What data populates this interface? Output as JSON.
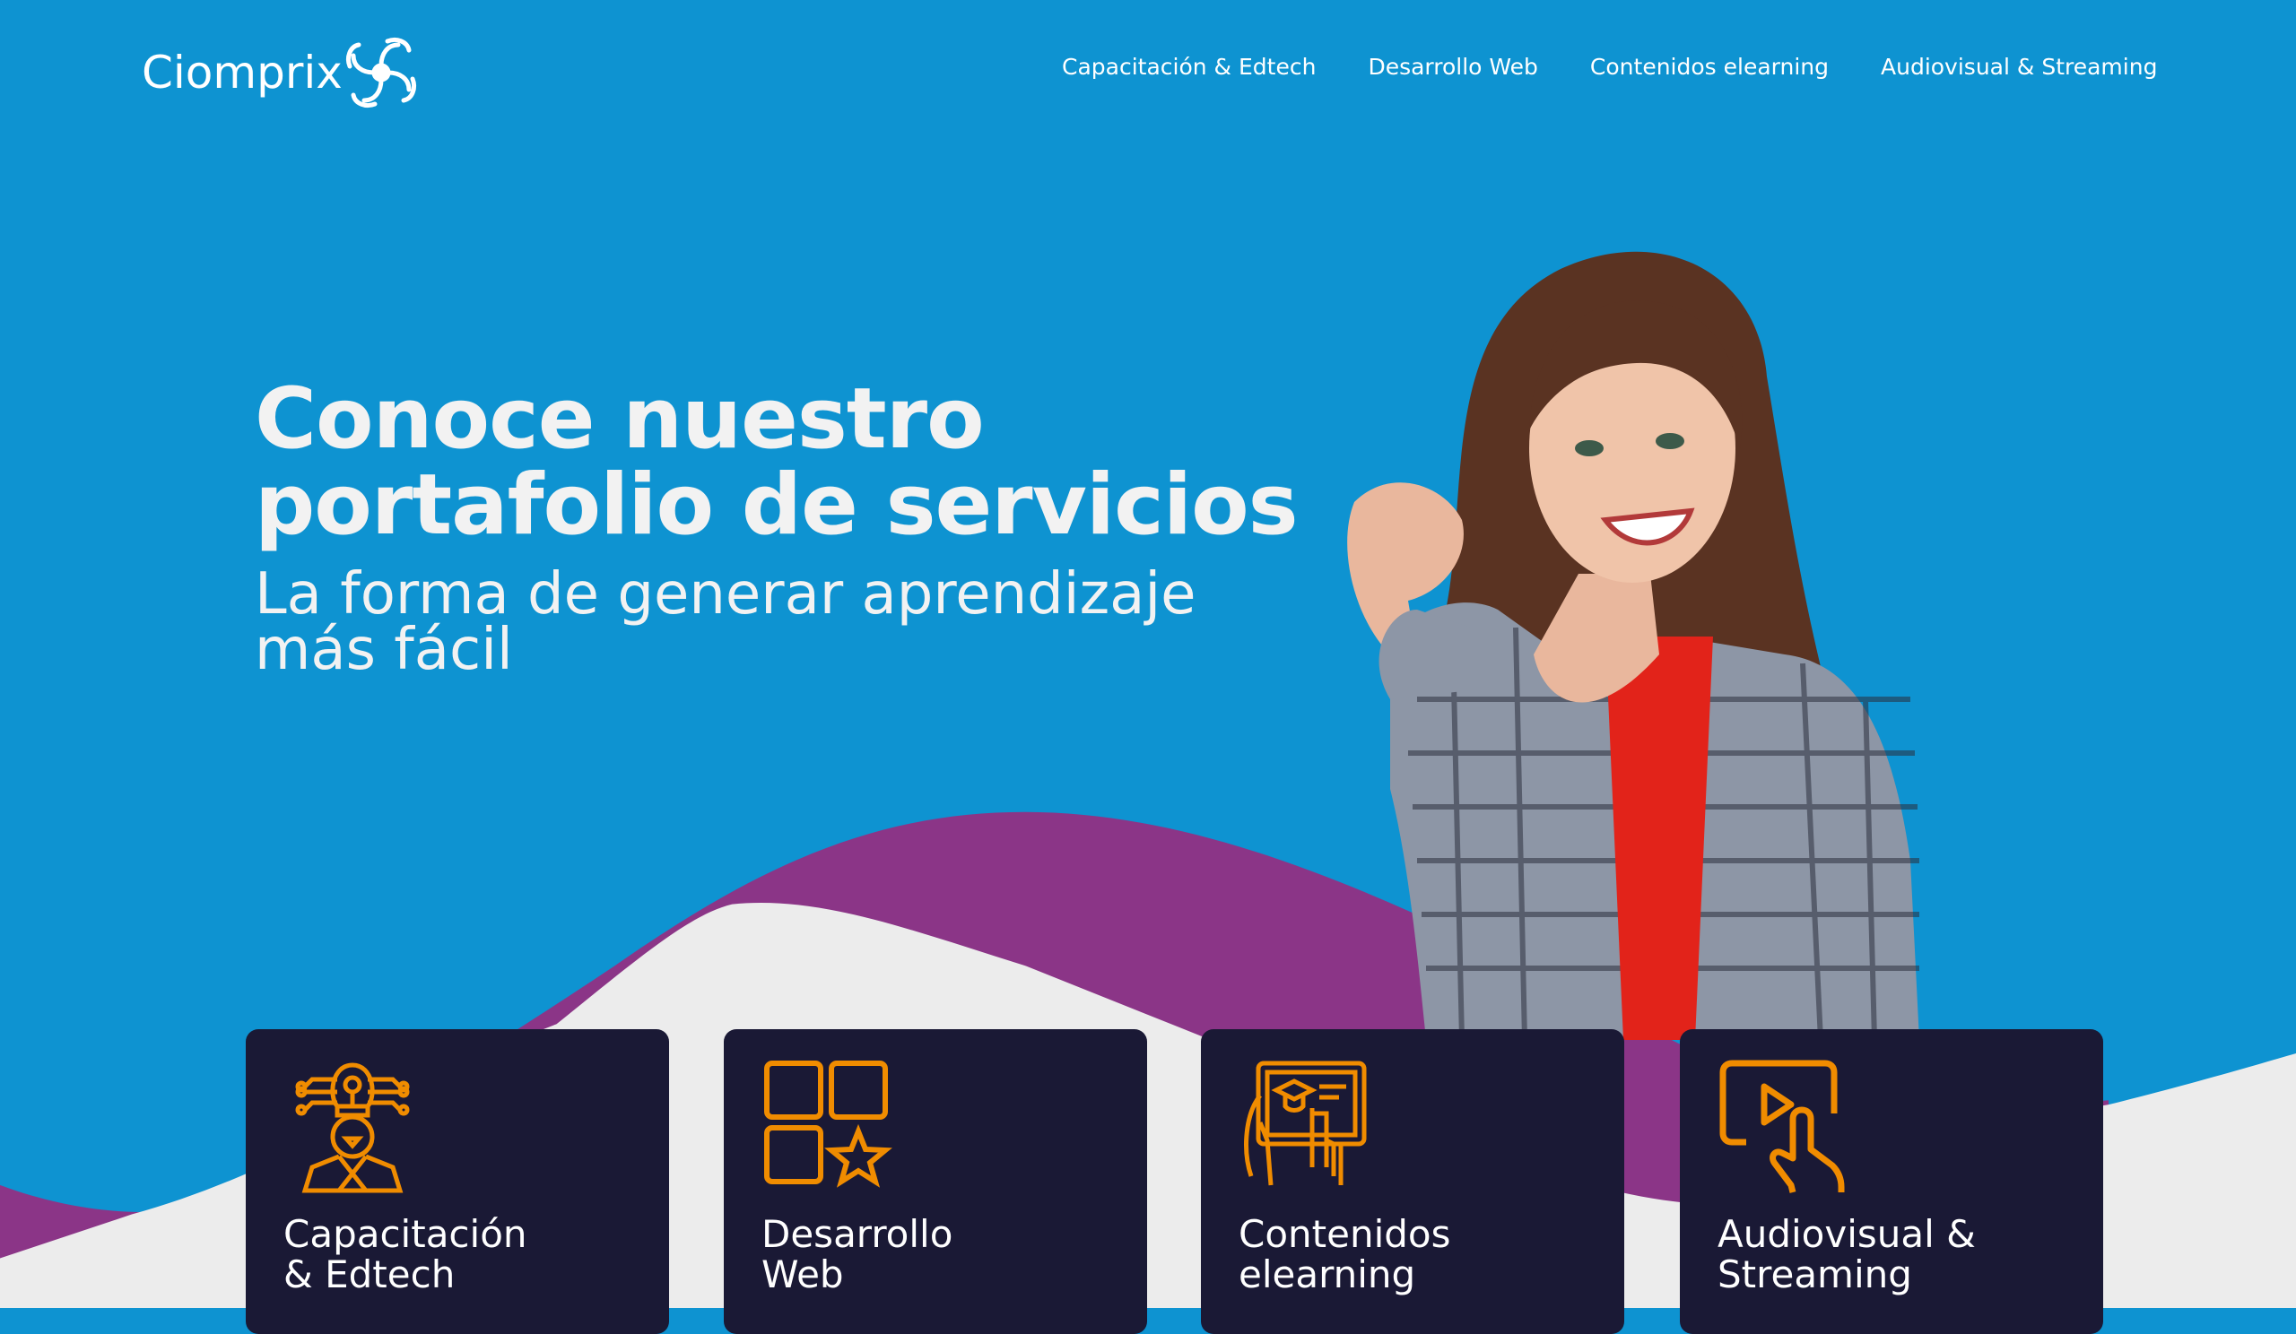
{
  "brand": {
    "name": "Ciomprix"
  },
  "nav": [
    {
      "label": "Capacitación  & Edtech"
    },
    {
      "label": "Desarrollo Web"
    },
    {
      "label": "Contenidos elearning"
    },
    {
      "label": "Audiovisual & Streaming"
    }
  ],
  "hero": {
    "title_line1": "Conoce nuestro",
    "title_line2": "portafolio de servicios",
    "subtitle_line1": "La forma de generar aprendizaje",
    "subtitle_line2": "más fácil"
  },
  "cards": [
    {
      "line1": "Capacitación",
      "line2": "& Edtech",
      "icon": "ai-person-icon"
    },
    {
      "line1": "Desarrollo",
      "line2": "Web",
      "icon": "app-grid-star-icon"
    },
    {
      "line1": "Contenidos",
      "line2": "elearning",
      "icon": "tablet-graduation-icon"
    },
    {
      "line1": "Audiovisual &",
      "line2": "Streaming",
      "icon": "play-touch-icon"
    }
  ],
  "colors": {
    "blue": "#0e93d1",
    "purple": "#8b3587",
    "gray": "#ececec",
    "card": "#1a1935",
    "accent": "#f08c00"
  }
}
